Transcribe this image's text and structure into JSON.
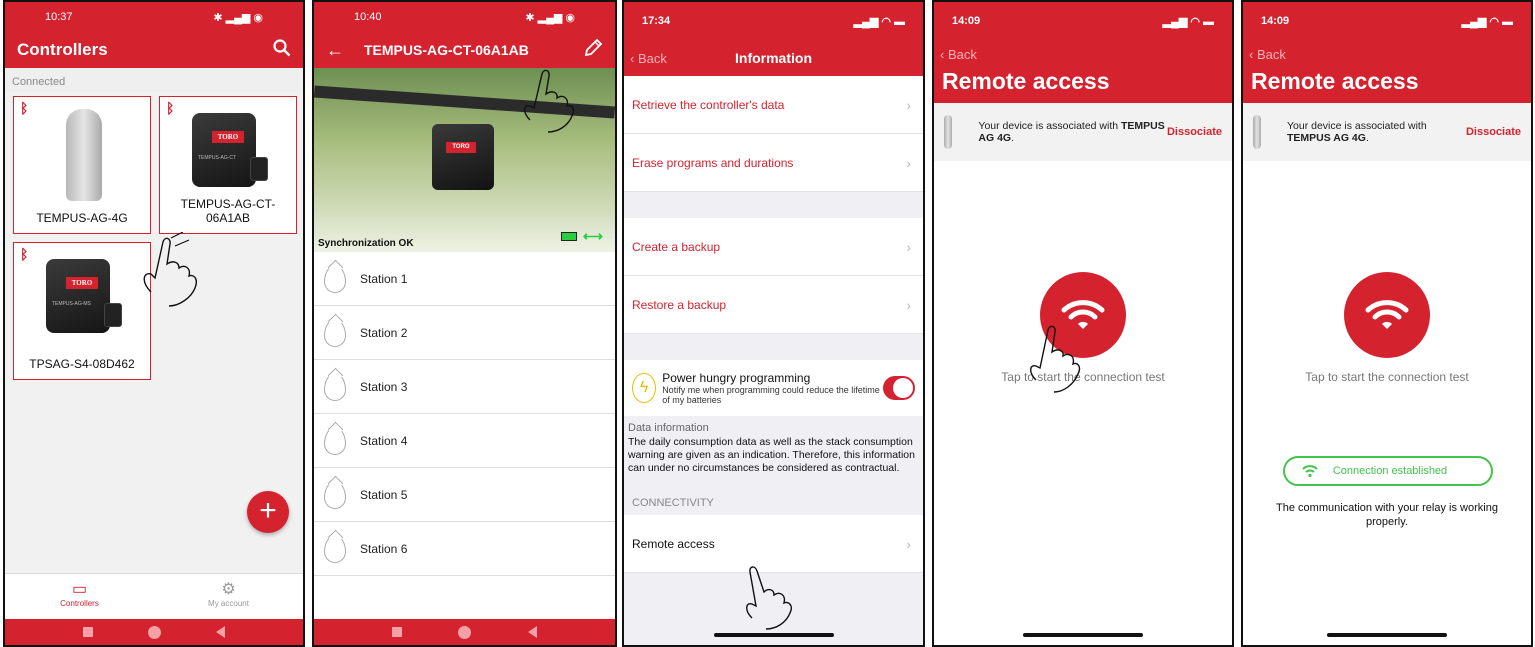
{
  "screen1": {
    "status_time": "10:37",
    "title": "Controllers",
    "section": "Connected",
    "cards": [
      {
        "name": "TEMPUS-AG-4G"
      },
      {
        "name": "TEMPUS-AG-CT-06A1AB",
        "logo": "TORO",
        "model": "TEMPUS-AG-CT"
      },
      {
        "name": "TPSAG-S4-08D462",
        "logo": "TORO",
        "model": "TEMPUS-AG-MS"
      }
    ],
    "fab": "+",
    "tabs": [
      {
        "label": "Controllers"
      },
      {
        "label": "My account"
      }
    ]
  },
  "screen2": {
    "status_time": "10:40",
    "title": "TEMPUS-AG-CT-06A1AB",
    "unit_logo": "TORO",
    "sync": "Synchronization OK",
    "stations": [
      "Station 1",
      "Station 2",
      "Station 3",
      "Station 4",
      "Station 5",
      "Station 6"
    ]
  },
  "screen3": {
    "status_time": "17:34",
    "back": "Back",
    "title": "Information",
    "rows_top": [
      "Retrieve the controller's data",
      "Erase programs and durations"
    ],
    "rows_mid": [
      "Create a backup",
      "Restore a backup"
    ],
    "power_title": "Power hungry programming",
    "power_desc": "Notify me when programming could reduce the lifetime of my batteries",
    "data_head": "Data information",
    "data_text": "The daily consumption data as well as the stack consumption warning are given as an indication. Therefore, this information can under no circumstances be considered as contractual.",
    "conn_head": "CONNECTIVITY",
    "remote": "Remote access"
  },
  "screen4": {
    "status_time": "14:09",
    "back": "Back",
    "title": "Remote access",
    "assoc_pre": "Your device is associated with ",
    "assoc_dev": "TEMPUS AG 4G",
    "dissociate": "Dissociate",
    "tap": "Tap to start the connection test"
  },
  "screen5": {
    "status_time": "14:09",
    "back": "Back",
    "title": "Remote access",
    "assoc_pre": "Your device is associated with ",
    "assoc_dev": "TEMPUS AG 4G",
    "dissociate": "Dissociate",
    "tap": "Tap to start the connection test",
    "established": "Connection established",
    "works": "The communication with your relay is working properly."
  },
  "colors": {
    "brand_red": "#d4232f",
    "success_green": "#45c24e"
  },
  "icons": [
    "search-icon",
    "back-arrow-icon",
    "edit-pencil-icon",
    "bluetooth-icon",
    "wifi-icon",
    "gear-icon",
    "chevron-right-icon",
    "bolt-icon"
  ]
}
